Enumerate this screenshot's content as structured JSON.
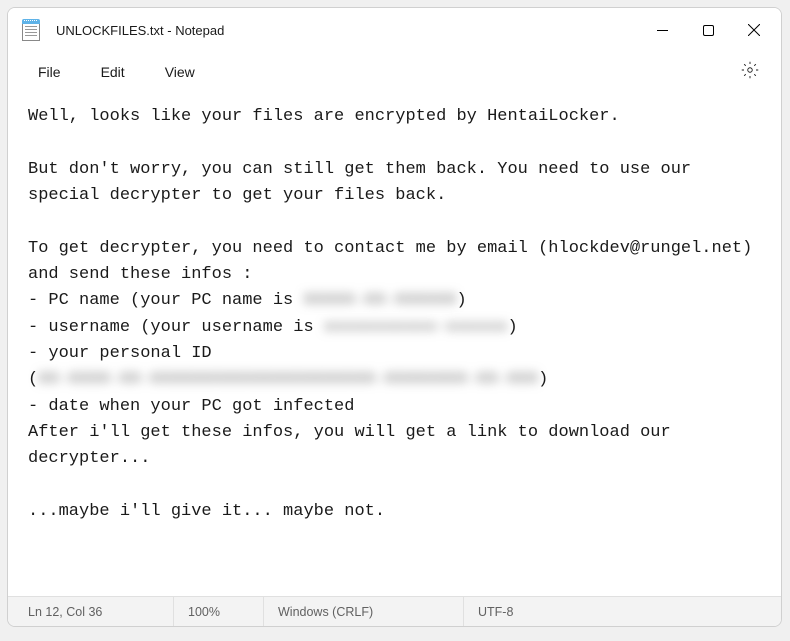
{
  "titlebar": {
    "title": "UNLOCKFILES.txt - Notepad"
  },
  "menu": {
    "file": "File",
    "edit": "Edit",
    "view": "View"
  },
  "content": {
    "line1": "Well, looks like your files are encrypted by HentaiLocker.",
    "line2": "",
    "line3": "But don't worry, you can still get them back. You need to use our special decrypter to get your files back.",
    "line4": "",
    "line5": "To get decrypter, you need to contact me by email (hlockdev@rungel.net) and send these infos :",
    "line6a": "- PC name (your PC name is ",
    "line6b": "XXXXX-XX-XXXXXX",
    "line6c": ")",
    "line7a": "- username (your username is ",
    "line7b": "xxxxxxxxxxx-xxxxxx",
    "line7c": ")",
    "line8": "- your personal ID",
    "line9a": "(",
    "line9b": "XX-XXXX-XX-XXXXXXXXXXXXXXXXXXXXXX-XXXXXXXX-XX-XXX",
    "line9c": ")",
    "line10": "- date when your PC got infected",
    "line11": "After i'll get these infos, you will get a link to download our decrypter...",
    "line12": "",
    "line13": "...maybe i'll give it... maybe not."
  },
  "statusbar": {
    "cursor": "Ln 12, Col 36",
    "zoom": "100%",
    "lineending": "Windows (CRLF)",
    "encoding": "UTF-8"
  }
}
